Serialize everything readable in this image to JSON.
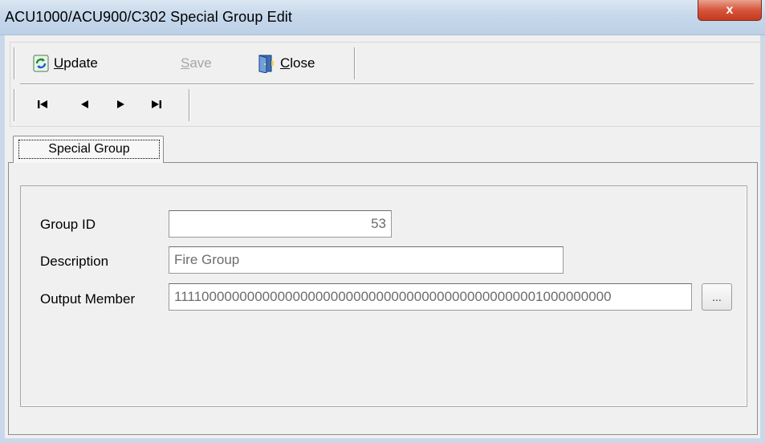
{
  "window": {
    "title": "ACU1000/ACU900/C302 Special Group Edit",
    "close_glyph": "x"
  },
  "toolbar": {
    "update": {
      "prefix": "",
      "mnemonic": "U",
      "rest": "pdate",
      "icon": "refresh-icon"
    },
    "save": {
      "mnemonic": "S",
      "rest": "ave",
      "enabled": false
    },
    "close": {
      "mnemonic": "C",
      "rest": "lose",
      "icon": "door-exit-icon"
    },
    "nav": [
      "first-record-icon",
      "previous-record-icon",
      "next-record-icon",
      "last-record-icon"
    ]
  },
  "tabs": [
    {
      "label": "Special Group",
      "active": true
    }
  ],
  "form": {
    "group_id": {
      "label": "Group ID",
      "value": "53"
    },
    "description": {
      "label": "Description",
      "value": "Fire Group"
    },
    "output_member": {
      "label": "Output Member",
      "value": "1111000000000000000000000000000000000000000000001000000000",
      "button": "..."
    }
  },
  "colors": {
    "window_bg": "#f0f0f0",
    "title_bg": "#c6d8eb",
    "close_red": "#d7553b",
    "disabled_text": "#a6a6a6",
    "field_text": "#6d6d6d"
  }
}
